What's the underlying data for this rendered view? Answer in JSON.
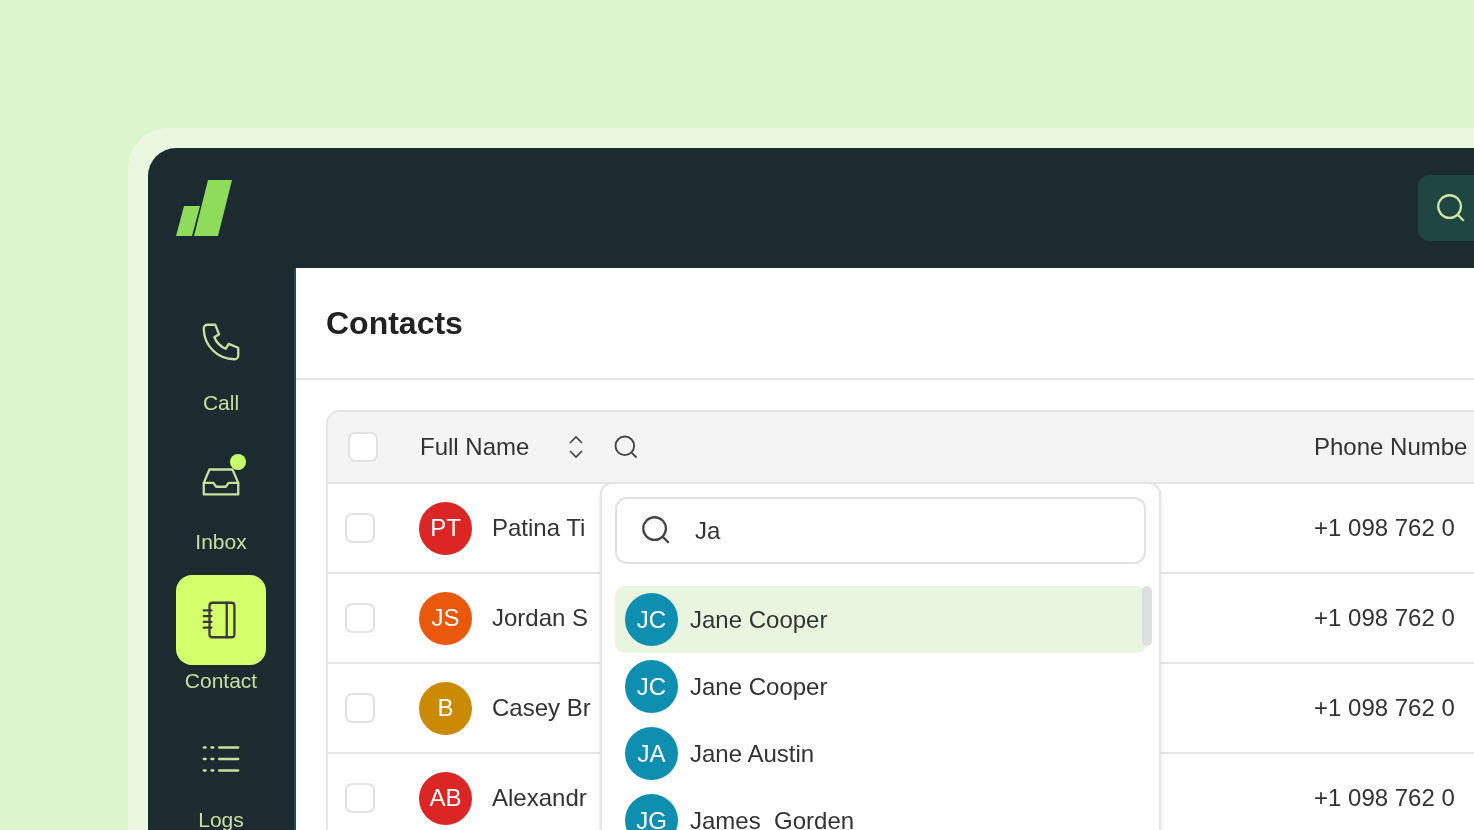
{
  "sidebar": {
    "items": [
      {
        "kind": "phone",
        "label": "Call",
        "selected": false,
        "badge": false
      },
      {
        "kind": "inbox",
        "label": "Inbox",
        "selected": false,
        "badge": true
      },
      {
        "kind": "notebook",
        "label": "Contact",
        "selected": true,
        "badge": false
      },
      {
        "kind": "list",
        "label": "Logs",
        "selected": false,
        "badge": false
      }
    ]
  },
  "page": {
    "title": "Contacts"
  },
  "table": {
    "columns": [
      "Full Name",
      "Phone Numbe"
    ],
    "select_all_checked": false,
    "rows": [
      {
        "initials": "PT",
        "color": "#dc2626",
        "name": "Patina Ti",
        "phone": "+1 098 762 0",
        "checked": false
      },
      {
        "initials": "JS",
        "color": "#ea580c",
        "name": "Jordan S",
        "phone": "+1 098 762 0",
        "checked": false
      },
      {
        "initials": "B",
        "color": "#ca8a04",
        "name": "Casey Br",
        "phone": "+1 098 762 0",
        "checked": false
      },
      {
        "initials": "AB",
        "color": "#dc2626",
        "name": "Alexandr",
        "phone": "+1 098 762 0",
        "checked": false
      }
    ]
  },
  "name_filter": {
    "query": "Ja",
    "results": [
      {
        "initials": "JC",
        "name": "Jane Cooper",
        "selected": true
      },
      {
        "initials": "JC",
        "name": "Jane Cooper",
        "selected": false
      },
      {
        "initials": "JA",
        "name": "Jane Austin",
        "selected": false
      },
      {
        "initials": "JG",
        "name": "James  Gorden",
        "selected": false
      }
    ]
  }
}
